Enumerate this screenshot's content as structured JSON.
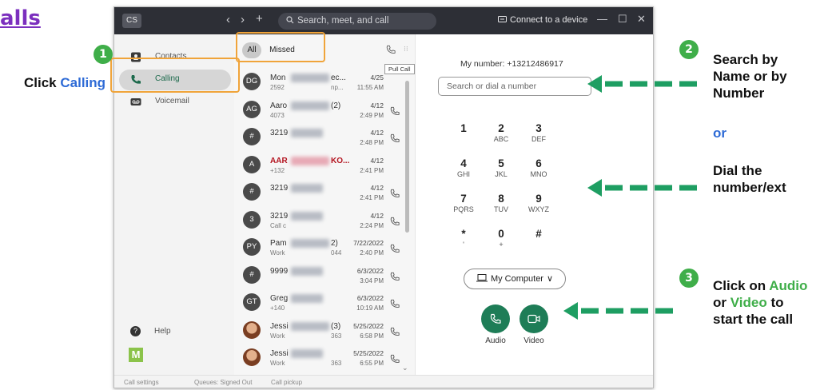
{
  "doc": {
    "title_fragment": "alls",
    "left_hint_prefix": "Click ",
    "left_hint_highlight": "Calling"
  },
  "window": {
    "avatar": "CS",
    "nav_back": "‹",
    "nav_fwd": "›",
    "nav_add": "+",
    "search_placeholder": "Search, meet, and call",
    "connect_label": "Connect to a device",
    "min": "—",
    "max": "☐",
    "close": "✕"
  },
  "sidebar": {
    "items": [
      {
        "label": "Contacts",
        "icon": "contacts-icon"
      },
      {
        "label": "Calling",
        "icon": "phone-icon",
        "active": true
      },
      {
        "label": "Voicemail",
        "icon": "voicemail-icon"
      }
    ],
    "help": "Help",
    "logo": "M"
  },
  "list": {
    "filter_all": "All",
    "filter_missed": "Missed",
    "tooltip": "Pull Call",
    "rows": [
      {
        "avatar": "DG",
        "name": "Mon",
        "name_tail": "ec...",
        "sub": "2592",
        "sub_tail": "np...",
        "date": "4/25",
        "time": "11:55 AM",
        "call": false
      },
      {
        "avatar": "AG",
        "name": "Aaro",
        "name_tail": "(2)",
        "sub": "4073",
        "sub_tail": "",
        "date": "4/12",
        "time": "2:49 PM",
        "call": true
      },
      {
        "avatar": "#",
        "name": "3219",
        "name_tail": "",
        "sub": "",
        "sub_tail": "",
        "date": "4/12",
        "time": "2:48 PM",
        "call": true
      },
      {
        "avatar": "A",
        "name": "AAR",
        "name_tail": "KO...",
        "sub": "+132",
        "sub_tail": "",
        "date": "4/12",
        "time": "2:41 PM",
        "call": false,
        "red": true
      },
      {
        "avatar": "#",
        "name": "3219",
        "name_tail": "",
        "sub": "",
        "sub_tail": "",
        "date": "4/12",
        "time": "2:41 PM",
        "call": true
      },
      {
        "avatar": "3",
        "name": "3219",
        "name_tail": "",
        "sub": "Call c",
        "sub_tail": "",
        "date": "4/12",
        "time": "2:24 PM",
        "call": true
      },
      {
        "avatar": "PY",
        "name": "Pam",
        "name_tail": "2)",
        "sub": "Work",
        "sub_tail": "044",
        "date": "7/22/2022",
        "time": "2:40 PM",
        "call": true
      },
      {
        "avatar": "#",
        "name": "9999",
        "name_tail": "",
        "sub": "",
        "sub_tail": "",
        "date": "6/3/2022",
        "time": "3:04 PM",
        "call": true
      },
      {
        "avatar": "GT",
        "name": "Greg",
        "name_tail": "",
        "sub": "+140",
        "sub_tail": "",
        "date": "6/3/2022",
        "time": "10:19 AM",
        "call": true
      },
      {
        "avatar": "",
        "name": "Jessi",
        "name_tail": "(3)",
        "sub": "Work",
        "sub_tail": "363",
        "date": "5/25/2022",
        "time": "6:58 PM",
        "call": true,
        "photo": true
      },
      {
        "avatar": "",
        "name": "Jessi",
        "name_tail": "",
        "sub": "Work",
        "sub_tail": "363",
        "date": "5/25/2022",
        "time": "6:55 PM",
        "call": true,
        "photo": true
      }
    ]
  },
  "dialpad": {
    "my_number": "My number: +13212486917",
    "input_placeholder": "Search or dial a number",
    "keys": [
      {
        "d": "1",
        "l": ""
      },
      {
        "d": "2",
        "l": "ABC"
      },
      {
        "d": "3",
        "l": "DEF"
      },
      {
        "d": "4",
        "l": "GHI"
      },
      {
        "d": "5",
        "l": "JKL"
      },
      {
        "d": "6",
        "l": "MNO"
      },
      {
        "d": "7",
        "l": "PQRS"
      },
      {
        "d": "8",
        "l": "TUV"
      },
      {
        "d": "9",
        "l": "WXYZ"
      },
      {
        "d": "*",
        "l": "'"
      },
      {
        "d": "0",
        "l": "+"
      },
      {
        "d": "#",
        "l": ""
      }
    ],
    "device": "My Computer",
    "audio": "Audio",
    "video": "Video"
  },
  "footer": {
    "items": [
      "Call settings",
      "Queues: Signed Out",
      "Call pickup"
    ]
  },
  "annotations": {
    "step1": "1",
    "step2": "2",
    "step3": "3",
    "search_by_1": "Search by",
    "search_by_2": "Name or by",
    "search_by_3": "Number",
    "or": "or",
    "dial_1": "Dial the",
    "dial_2": "number/ext",
    "click_on": "Click on ",
    "audio": "Audio",
    "or_word": "or ",
    "video": "Video",
    "to": " to",
    "start": "start the call"
  },
  "colors": {
    "accent_green": "#1e7d57",
    "annotation_green": "#3fae49",
    "annotation_orange": "#f0a43a",
    "annotation_blue": "#2e6bd6",
    "title_purple": "#7b2fbe"
  }
}
